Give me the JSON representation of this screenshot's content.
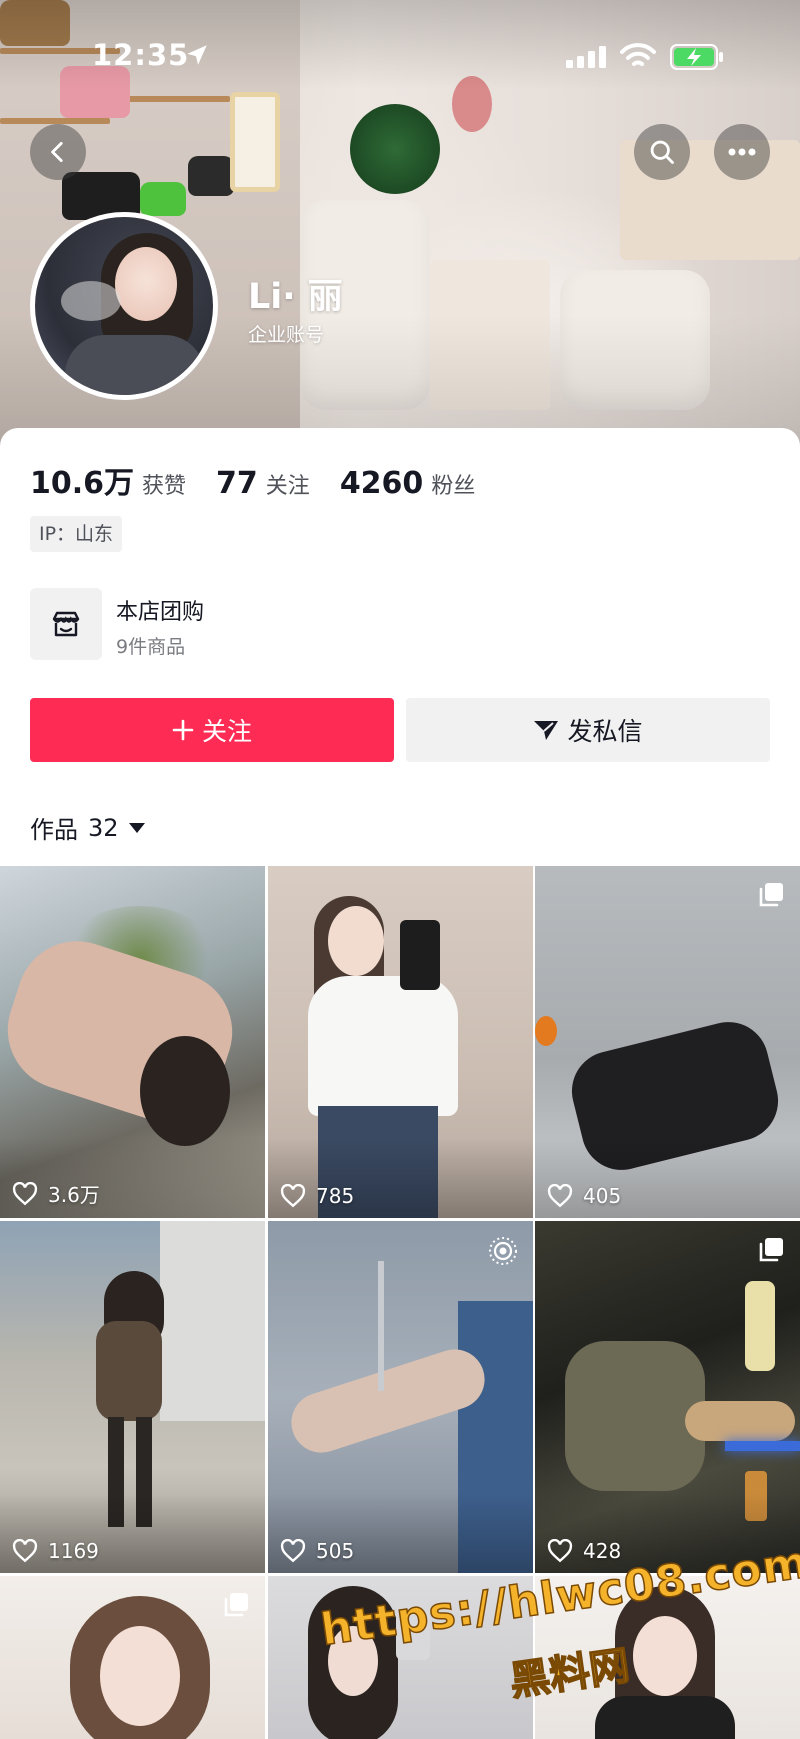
{
  "status_bar": {
    "time": "12:35"
  },
  "profile": {
    "name": "Li· 丽",
    "subtitle": "企业账号",
    "stats": [
      {
        "num": "10.6万",
        "label": "获赞"
      },
      {
        "num": "77",
        "label": "关注"
      },
      {
        "num": "4260",
        "label": "粉丝"
      }
    ],
    "ip": "IP：山东"
  },
  "shop": {
    "title": "本店团购",
    "subtitle": "9件商品"
  },
  "actions": {
    "follow": "关注",
    "message": "发私信"
  },
  "works": {
    "label": "作品",
    "count": "32"
  },
  "videos": [
    {
      "likes": "3.6万",
      "badge": ""
    },
    {
      "likes": "785",
      "badge": ""
    },
    {
      "likes": "405",
      "badge": "multi-image-icon"
    },
    {
      "likes": "1169",
      "badge": ""
    },
    {
      "likes": "505",
      "badge": "live-photo-icon"
    },
    {
      "likes": "428",
      "badge": "multi-image-icon"
    },
    {
      "likes": "",
      "badge": "multi-image-icon"
    },
    {
      "likes": "",
      "badge": ""
    },
    {
      "likes": "",
      "badge": ""
    }
  ],
  "watermark": {
    "url": "https://hlwc08.com",
    "name": "黑料网"
  },
  "colors": {
    "accent": "#fe2c55",
    "text": "#161823",
    "muted": "#7b7c82",
    "chip": "#f1f1f2"
  }
}
